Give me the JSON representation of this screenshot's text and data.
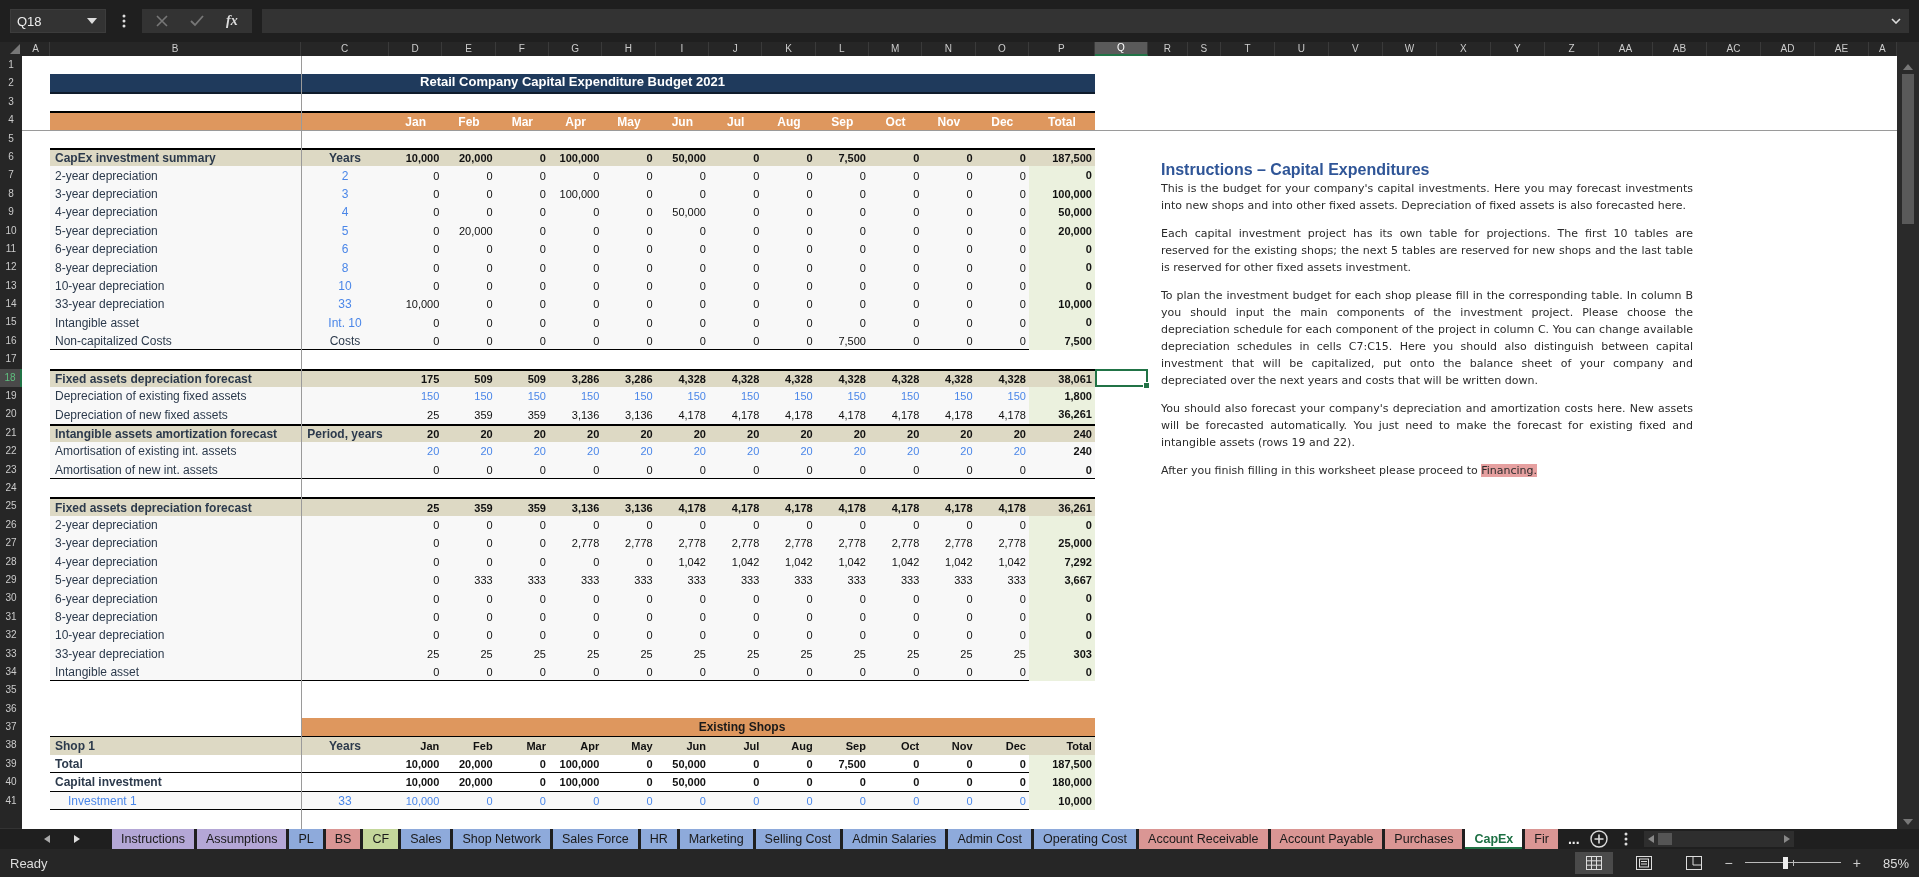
{
  "formula_bar": {
    "name_box": "Q18",
    "fx": "fx"
  },
  "columns": [
    {
      "label": "A",
      "selected": false
    },
    {
      "label": "B",
      "selected": false
    },
    {
      "label": "C",
      "selected": false
    },
    {
      "label": "D",
      "selected": false
    },
    {
      "label": "E",
      "selected": false
    },
    {
      "label": "F",
      "selected": false
    },
    {
      "label": "G",
      "selected": false
    },
    {
      "label": "H",
      "selected": false
    },
    {
      "label": "I",
      "selected": false
    },
    {
      "label": "J",
      "selected": false
    },
    {
      "label": "K",
      "selected": false
    },
    {
      "label": "L",
      "selected": false
    },
    {
      "label": "M",
      "selected": false
    },
    {
      "label": "N",
      "selected": false
    },
    {
      "label": "O",
      "selected": false
    },
    {
      "label": "P",
      "selected": false
    },
    {
      "label": "Q",
      "selected": true
    },
    {
      "label": "R",
      "selected": false
    },
    {
      "label": "S",
      "selected": false
    },
    {
      "label": "T",
      "selected": false
    },
    {
      "label": "U",
      "selected": false
    },
    {
      "label": "V",
      "selected": false
    },
    {
      "label": "W",
      "selected": false
    },
    {
      "label": "X",
      "selected": false
    },
    {
      "label": "Y",
      "selected": false
    },
    {
      "label": "Z",
      "selected": false
    },
    {
      "label": "AA",
      "selected": false
    },
    {
      "label": "AB",
      "selected": false
    },
    {
      "label": "AC",
      "selected": false
    },
    {
      "label": "AD",
      "selected": false
    },
    {
      "label": "AE",
      "selected": false
    },
    {
      "label": "A",
      "selected": false
    }
  ],
  "rows": [
    {
      "number": "1",
      "selected": false,
      "kind": "blank"
    },
    {
      "number": "2",
      "selected": false,
      "kind": "title",
      "title": "Retail Company Capital Expenditure Budget 2021"
    },
    {
      "number": "3",
      "selected": false,
      "kind": "blank"
    },
    {
      "number": "4",
      "selected": false,
      "kind": "months",
      "months": [
        "Jan",
        "Feb",
        "Mar",
        "Apr",
        "May",
        "Jun",
        "Jul",
        "Aug",
        "Sep",
        "Oct",
        "Nov",
        "Dec"
      ],
      "total": "Total"
    },
    {
      "number": "5",
      "selected": false,
      "kind": "blank"
    },
    {
      "number": "6",
      "selected": false,
      "kind": "section",
      "b": "CapEx investment summary",
      "c": "Years",
      "values": [
        "10,000",
        "20,000",
        "0",
        "100,000",
        "0",
        "50,000",
        "0",
        "0",
        "7,500",
        "0",
        "0",
        "0"
      ],
      "total": "187,500"
    },
    {
      "number": "7",
      "selected": false,
      "kind": "item",
      "b": "2-year depreciation",
      "c": "2",
      "b_input": false,
      "c_input": true,
      "months_input": false,
      "bold": false,
      "total_shaded": true,
      "values": [
        "0",
        "0",
        "0",
        "0",
        "0",
        "0",
        "0",
        "0",
        "0",
        "0",
        "0",
        "0"
      ],
      "total": "0"
    },
    {
      "number": "8",
      "selected": false,
      "kind": "item",
      "b": "3-year depreciation",
      "c": "3",
      "b_input": false,
      "c_input": true,
      "months_input": false,
      "bold": false,
      "total_shaded": true,
      "values": [
        "0",
        "0",
        "0",
        "100,000",
        "0",
        "0",
        "0",
        "0",
        "0",
        "0",
        "0",
        "0"
      ],
      "total": "100,000"
    },
    {
      "number": "9",
      "selected": false,
      "kind": "item",
      "b": "4-year depreciation",
      "c": "4",
      "b_input": false,
      "c_input": true,
      "months_input": false,
      "bold": false,
      "total_shaded": true,
      "values": [
        "0",
        "0",
        "0",
        "0",
        "0",
        "50,000",
        "0",
        "0",
        "0",
        "0",
        "0",
        "0"
      ],
      "total": "50,000"
    },
    {
      "number": "10",
      "selected": false,
      "kind": "item",
      "b": "5-year depreciation",
      "c": "5",
      "b_input": false,
      "c_input": true,
      "months_input": false,
      "bold": false,
      "total_shaded": true,
      "values": [
        "0",
        "20,000",
        "0",
        "0",
        "0",
        "0",
        "0",
        "0",
        "0",
        "0",
        "0",
        "0"
      ],
      "total": "20,000"
    },
    {
      "number": "11",
      "selected": false,
      "kind": "item",
      "b": "6-year depreciation",
      "c": "6",
      "b_input": false,
      "c_input": true,
      "months_input": false,
      "bold": false,
      "total_shaded": true,
      "values": [
        "0",
        "0",
        "0",
        "0",
        "0",
        "0",
        "0",
        "0",
        "0",
        "0",
        "0",
        "0"
      ],
      "total": "0"
    },
    {
      "number": "12",
      "selected": false,
      "kind": "item",
      "b": "8-year depreciation",
      "c": "8",
      "b_input": false,
      "c_input": true,
      "months_input": false,
      "bold": false,
      "total_shaded": true,
      "values": [
        "0",
        "0",
        "0",
        "0",
        "0",
        "0",
        "0",
        "0",
        "0",
        "0",
        "0",
        "0"
      ],
      "total": "0"
    },
    {
      "number": "13",
      "selected": false,
      "kind": "item",
      "b": "10-year depreciation",
      "c": "10",
      "b_input": false,
      "c_input": true,
      "months_input": false,
      "bold": false,
      "total_shaded": true,
      "values": [
        "0",
        "0",
        "0",
        "0",
        "0",
        "0",
        "0",
        "0",
        "0",
        "0",
        "0",
        "0"
      ],
      "total": "0"
    },
    {
      "number": "14",
      "selected": false,
      "kind": "item",
      "b": "33-year depreciation",
      "c": "33",
      "b_input": false,
      "c_input": true,
      "months_input": false,
      "bold": false,
      "total_shaded": true,
      "values": [
        "10,000",
        "0",
        "0",
        "0",
        "0",
        "0",
        "0",
        "0",
        "0",
        "0",
        "0",
        "0"
      ],
      "total": "10,000"
    },
    {
      "number": "15",
      "selected": false,
      "kind": "item",
      "b": "Intangible asset",
      "c": "Int. 10",
      "b_input": false,
      "c_input": true,
      "months_input": false,
      "bold": false,
      "total_shaded": true,
      "values": [
        "0",
        "0",
        "0",
        "0",
        "0",
        "0",
        "0",
        "0",
        "0",
        "0",
        "0",
        "0"
      ],
      "total": "0"
    },
    {
      "number": "16",
      "selected": false,
      "kind": "item",
      "b": "Non-capitalized Costs",
      "c": "Costs",
      "b_input": false,
      "c_input": false,
      "months_input": false,
      "bold": false,
      "total_shaded": true,
      "values": [
        "0",
        "0",
        "0",
        "0",
        "0",
        "0",
        "0",
        "0",
        "7,500",
        "0",
        "0",
        "0"
      ],
      "total": "7,500"
    },
    {
      "number": "17",
      "selected": false,
      "kind": "blank"
    },
    {
      "number": "18",
      "selected": true,
      "kind": "section",
      "b": "Fixed assets depreciation forecast",
      "values": [
        "175",
        "509",
        "509",
        "3,286",
        "3,286",
        "4,328",
        "4,328",
        "4,328",
        "4,328",
        "4,328",
        "4,328",
        "4,328"
      ],
      "total": "38,061"
    },
    {
      "number": "19",
      "selected": false,
      "kind": "item",
      "b": "Depreciation of existing fixed assets",
      "b_input": false,
      "months_input": true,
      "bold": false,
      "total_shaded": true,
      "values": [
        "150",
        "150",
        "150",
        "150",
        "150",
        "150",
        "150",
        "150",
        "150",
        "150",
        "150",
        "150"
      ],
      "total": "1,800"
    },
    {
      "number": "20",
      "selected": false,
      "kind": "item",
      "b": "Depreciation of new fixed assets",
      "b_input": false,
      "months_input": false,
      "bold": false,
      "total_shaded": true,
      "values": [
        "25",
        "359",
        "359",
        "3,136",
        "3,136",
        "4,178",
        "4,178",
        "4,178",
        "4,178",
        "4,178",
        "4,178",
        "4,178"
      ],
      "total": "36,261"
    },
    {
      "number": "21",
      "selected": false,
      "kind": "section",
      "b": "Intangible assets amortization forecast",
      "c": "Period, years",
      "values": [
        "20",
        "20",
        "20",
        "20",
        "20",
        "20",
        "20",
        "20",
        "20",
        "20",
        "20",
        "20"
      ],
      "total": "240"
    },
    {
      "number": "22",
      "selected": false,
      "kind": "item",
      "b": "Amortisation of existing int. assets",
      "b_input": false,
      "months_input": true,
      "bold": false,
      "total_shaded": false,
      "values": [
        "20",
        "20",
        "20",
        "20",
        "20",
        "20",
        "20",
        "20",
        "20",
        "20",
        "20",
        "20"
      ],
      "total": "240"
    },
    {
      "number": "23",
      "selected": false,
      "kind": "item",
      "b": "Amortisation of new int. assets",
      "b_input": false,
      "months_input": false,
      "bold": false,
      "total_shaded": false,
      "values": [
        "0",
        "0",
        "0",
        "0",
        "0",
        "0",
        "0",
        "0",
        "0",
        "0",
        "0",
        "0"
      ],
      "total": "0"
    },
    {
      "number": "24",
      "selected": false,
      "kind": "blank"
    },
    {
      "number": "25",
      "selected": false,
      "kind": "section",
      "b": "Fixed assets depreciation forecast",
      "values": [
        "25",
        "359",
        "359",
        "3,136",
        "3,136",
        "4,178",
        "4,178",
        "4,178",
        "4,178",
        "4,178",
        "4,178",
        "4,178"
      ],
      "total": "36,261"
    },
    {
      "number": "26",
      "selected": false,
      "kind": "item",
      "b": "2-year depreciation",
      "b_input": false,
      "months_input": false,
      "bold": false,
      "total_shaded": true,
      "values": [
        "0",
        "0",
        "0",
        "0",
        "0",
        "0",
        "0",
        "0",
        "0",
        "0",
        "0",
        "0"
      ],
      "total": "0"
    },
    {
      "number": "27",
      "selected": false,
      "kind": "item",
      "b": "3-year depreciation",
      "b_input": false,
      "months_input": false,
      "bold": false,
      "total_shaded": true,
      "values": [
        "0",
        "0",
        "0",
        "2,778",
        "2,778",
        "2,778",
        "2,778",
        "2,778",
        "2,778",
        "2,778",
        "2,778",
        "2,778"
      ],
      "total": "25,000"
    },
    {
      "number": "28",
      "selected": false,
      "kind": "item",
      "b": "4-year depreciation",
      "b_input": false,
      "months_input": false,
      "bold": false,
      "total_shaded": true,
      "values": [
        "0",
        "0",
        "0",
        "0",
        "0",
        "1,042",
        "1,042",
        "1,042",
        "1,042",
        "1,042",
        "1,042",
        "1,042"
      ],
      "total": "7,292"
    },
    {
      "number": "29",
      "selected": false,
      "kind": "item",
      "b": "5-year depreciation",
      "b_input": false,
      "months_input": false,
      "bold": false,
      "total_shaded": true,
      "values": [
        "0",
        "333",
        "333",
        "333",
        "333",
        "333",
        "333",
        "333",
        "333",
        "333",
        "333",
        "333"
      ],
      "total": "3,667"
    },
    {
      "number": "30",
      "selected": false,
      "kind": "item",
      "b": "6-year depreciation",
      "b_input": false,
      "months_input": false,
      "bold": false,
      "total_shaded": true,
      "values": [
        "0",
        "0",
        "0",
        "0",
        "0",
        "0",
        "0",
        "0",
        "0",
        "0",
        "0",
        "0"
      ],
      "total": "0"
    },
    {
      "number": "31",
      "selected": false,
      "kind": "item",
      "b": "8-year depreciation",
      "b_input": false,
      "months_input": false,
      "bold": false,
      "total_shaded": true,
      "values": [
        "0",
        "0",
        "0",
        "0",
        "0",
        "0",
        "0",
        "0",
        "0",
        "0",
        "0",
        "0"
      ],
      "total": "0"
    },
    {
      "number": "32",
      "selected": false,
      "kind": "item",
      "b": "10-year depreciation",
      "b_input": false,
      "months_input": false,
      "bold": false,
      "total_shaded": true,
      "values": [
        "0",
        "0",
        "0",
        "0",
        "0",
        "0",
        "0",
        "0",
        "0",
        "0",
        "0",
        "0"
      ],
      "total": "0"
    },
    {
      "number": "33",
      "selected": false,
      "kind": "item",
      "b": "33-year depreciation",
      "b_input": false,
      "months_input": false,
      "bold": false,
      "total_shaded": true,
      "values": [
        "25",
        "25",
        "25",
        "25",
        "25",
        "25",
        "25",
        "25",
        "25",
        "25",
        "25",
        "25"
      ],
      "total": "303"
    },
    {
      "number": "34",
      "selected": false,
      "kind": "item",
      "b": "Intangible asset",
      "b_input": false,
      "months_input": false,
      "bold": false,
      "total_shaded": true,
      "values": [
        "0",
        "0",
        "0",
        "0",
        "0",
        "0",
        "0",
        "0",
        "0",
        "0",
        "0",
        "0"
      ],
      "total": "0"
    },
    {
      "number": "35",
      "selected": false,
      "kind": "blank"
    },
    {
      "number": "36",
      "selected": false,
      "kind": "blank"
    },
    {
      "number": "37",
      "selected": false,
      "kind": "banner",
      "title": "Existing Shops"
    },
    {
      "number": "38",
      "selected": false,
      "kind": "shop_header",
      "b": "Shop 1",
      "c": "Years",
      "months": [
        "Jan",
        "Feb",
        "Mar",
        "Apr",
        "May",
        "Jun",
        "Jul",
        "Aug",
        "Sep",
        "Oct",
        "Nov",
        "Dec"
      ],
      "total": "Total"
    },
    {
      "number": "39",
      "selected": false,
      "kind": "item",
      "b": "Total",
      "b_input": false,
      "months_input": false,
      "bold": true,
      "total_shaded": true,
      "values": [
        "10,000",
        "20,000",
        "0",
        "100,000",
        "0",
        "50,000",
        "0",
        "0",
        "7,500",
        "0",
        "0",
        "0"
      ],
      "total": "187,500"
    },
    {
      "number": "40",
      "selected": false,
      "kind": "item",
      "b": "Capital investment",
      "b_input": false,
      "months_input": false,
      "bold": true,
      "total_shaded": true,
      "values": [
        "10,000",
        "20,000",
        "0",
        "100,000",
        "0",
        "50,000",
        "0",
        "0",
        "0",
        "0",
        "0",
        "0"
      ],
      "total": "180,000"
    },
    {
      "number": "41",
      "selected": false,
      "kind": "item",
      "b": "Investment 1",
      "c": "33",
      "b_input": true,
      "c_input": true,
      "months_input": true,
      "bold": false,
      "total_shaded": true,
      "values": [
        "10,000",
        "0",
        "0",
        "0",
        "0",
        "0",
        "0",
        "0",
        "0",
        "0",
        "0",
        "0"
      ],
      "total": "10,000"
    }
  ],
  "instructions": {
    "title": "Instructions – Capital Expenditures",
    "paragraphs": [
      "This is the budget for your company's capital investments. Here you may forecast investments into new shops and into other fixed assets. Depreciation of fixed assets is also forecasted here.",
      "Each capital investment project has its own table for projections. The first 10 tables are reserved for the existing shops; the next 5 tables are reserved for new shops and the last table is reserved for other fixed assets investment.",
      "To plan the investment budget for each shop please fill in the corresponding table. In column B you should input the main components of the investment project. Please choose the depreciation schedule for each component of the project in column C. You can change available depreciation schedules in cells C7:C15. Here you should also distinguish between capital investment that will be capitalized, put onto the balance sheet of your company and depreciated over the next years and costs that will be written down.",
      "You should also forecast your company's depreciation and amortization costs here. New assets will be forecasted automatically. You just need to make the forecast for existing fixed and intangible assets (rows 19 and 22)."
    ],
    "closing": "After you finish filling in this worksheet please proceed to",
    "link": "Financing."
  },
  "sheet_tabs": [
    {
      "label": "Instructions",
      "color": "#b4a7d6",
      "selected": false
    },
    {
      "label": "Assumptions",
      "color": "#b4a7d6",
      "selected": false
    },
    {
      "label": "PL",
      "color": "#8eaadb",
      "selected": false
    },
    {
      "label": "BS",
      "color": "#da9694",
      "selected": false
    },
    {
      "label": "CF",
      "color": "#c4d79b",
      "selected": false
    },
    {
      "label": "Sales",
      "color": "#8eaadb",
      "selected": false
    },
    {
      "label": "Shop Network",
      "color": "#8eaadb",
      "selected": false
    },
    {
      "label": "Sales Force",
      "color": "#8eaadb",
      "selected": false
    },
    {
      "label": "HR",
      "color": "#8eaadb",
      "selected": false
    },
    {
      "label": "Marketing",
      "color": "#8eaadb",
      "selected": false
    },
    {
      "label": "Selling Cost",
      "color": "#8eaadb",
      "selected": false
    },
    {
      "label": "Admin Salaries",
      "color": "#8eaadb",
      "selected": false
    },
    {
      "label": "Admin Cost",
      "color": "#8eaadb",
      "selected": false
    },
    {
      "label": "Operating Cost",
      "color": "#8eaadb",
      "selected": false
    },
    {
      "label": "Account Receivable",
      "color": "#da9694",
      "selected": false
    },
    {
      "label": "Account Payable",
      "color": "#da9694",
      "selected": false
    },
    {
      "label": "Purchases",
      "color": "#da9694",
      "selected": false
    },
    {
      "label": "CapEx",
      "selected": true
    },
    {
      "label": "Fir",
      "color": "#da9694",
      "selected": false
    }
  ],
  "tab_overflow": "...",
  "status_bar": {
    "status": "Ready",
    "zoom_out": "−",
    "zoom_in": "+",
    "zoom": {
      "level": 0.42,
      "reading": "85%"
    }
  }
}
